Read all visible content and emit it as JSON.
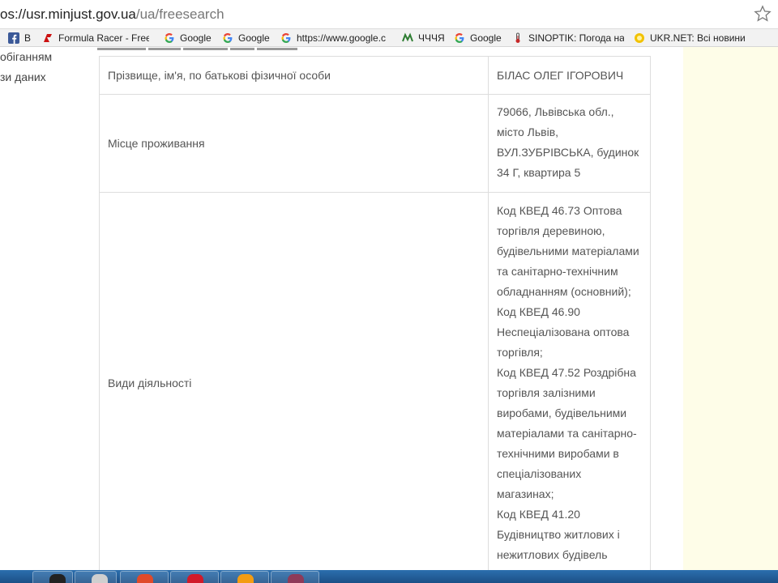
{
  "browser": {
    "url_visible": "os://usr.minjust.gov.ua",
    "url_path": "/ua/freesearch"
  },
  "bookmarks": [
    {
      "label": "B",
      "icon": "facebook-icon",
      "color": "#3b5998"
    },
    {
      "label": "Formula Racer - Free",
      "icon": "formula-racer-icon",
      "color": "#cc1111"
    },
    {
      "label": "Google",
      "icon": "google-icon",
      "color": "#4285f4"
    },
    {
      "label": "Google",
      "icon": "google-icon",
      "color": "#4285f4"
    },
    {
      "label": "https://www.google.c",
      "icon": "google-icon",
      "color": "#4285f4"
    },
    {
      "label": "ЧЧЧЯ",
      "icon": "page-icon",
      "color": "#2e7d32"
    },
    {
      "label": "Google",
      "icon": "google-icon",
      "color": "#4285f4"
    },
    {
      "label": "SINOPTIK: Погода на",
      "icon": "thermometer-icon",
      "color": "#555555"
    },
    {
      "label": "UKR.NET: Всі новини",
      "icon": "ukrnet-icon",
      "color": "#f2c200"
    }
  ],
  "left_nav": [
    "обіганням",
    "зи даних"
  ],
  "table": {
    "rows": [
      {
        "label": "Прізвище, ім'я, по батькові фізичної особи",
        "value_lines": [
          "БІЛАС ОЛЕГ ІГОРОВИЧ"
        ]
      },
      {
        "label": "Місце проживання",
        "value_lines": [
          "79066, Львівська обл.,",
          "місто Львів,",
          "ВУЛ.ЗУБРІВСЬКА, будинок",
          "34 Г, квартира 5"
        ]
      },
      {
        "label": "Види діяльності",
        "value_lines": [
          "Код КВЕД 46.73 Оптова",
          "торгівля деревиною,",
          "будівельними матеріалами",
          "та санітарно-технічним",
          "обладнанням (основний);",
          "Код КВЕД 46.90",
          "Неспеціалізована оптова",
          "торгівля;",
          "Код КВЕД 47.52 Роздрібна",
          "торгівля залізними",
          "виробами, будівельними",
          "матеріалами та санітарно-",
          "технічними виробами в",
          "спеціалізованих",
          "магазинах;",
          "Код КВЕД 41.20",
          "Будівництво житлових і",
          "нежитлових будівель"
        ]
      }
    ]
  },
  "colors": {
    "right_panel": "#fefde8",
    "table_border": "#dddddd",
    "text": "#555555"
  }
}
